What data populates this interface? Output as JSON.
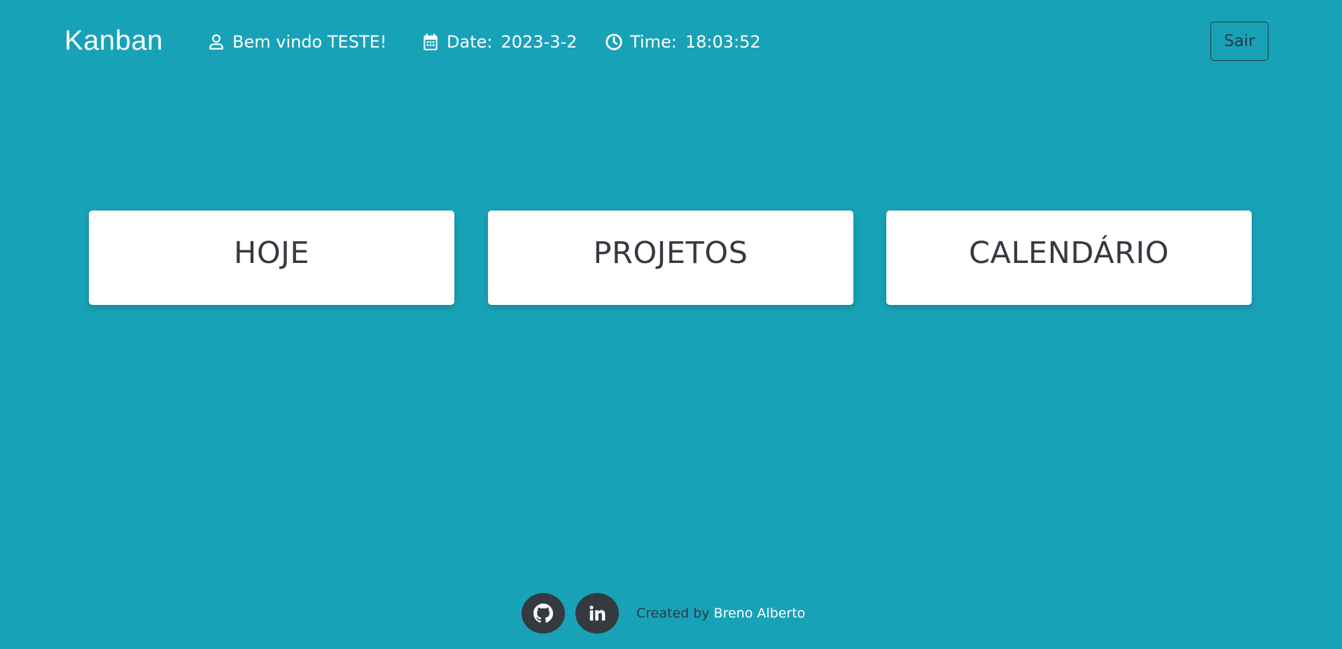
{
  "header": {
    "brand": "Kanban",
    "welcome": "Bem vindo TESTE!",
    "date_label": "Date:",
    "date_value": "2023-3-2",
    "time_label": "Time:",
    "time_value": "18:03:52",
    "logout_label": "Sair"
  },
  "cards": [
    {
      "label": "HOJE"
    },
    {
      "label": "PROJETOS"
    },
    {
      "label": "CALENDÁRIO"
    }
  ],
  "footer": {
    "created_by": "Created by",
    "author": "Breno Alberto",
    "icons": [
      "github-icon",
      "linkedin-icon"
    ]
  },
  "colors": {
    "background": "#18a2b8",
    "card": "#ffffff",
    "card_text": "#343a40",
    "social_button": "#343a40",
    "header_text": "#ffffff"
  }
}
